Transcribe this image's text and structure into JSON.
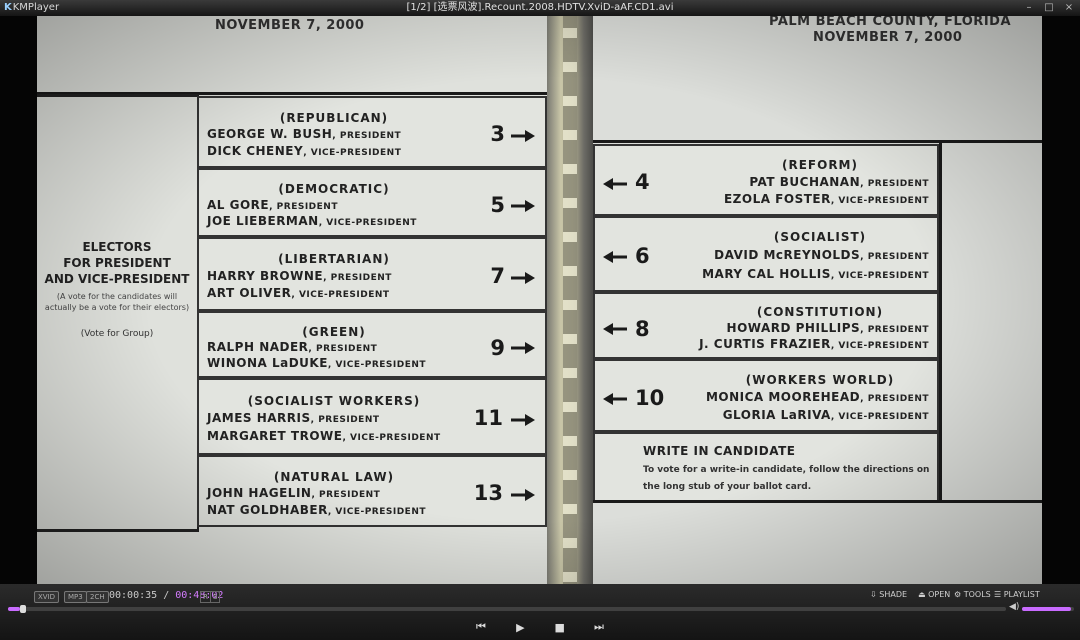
{
  "app": {
    "name": "KMPlayer",
    "title": "[1/2] [选票风波].Recount.2008.HDTV.XviD-aAF.CD1.avi"
  },
  "window_buttons": [
    "–",
    "□",
    "×"
  ],
  "ballot": {
    "left_date": "NOVEMBER 7, 2000",
    "right_county": "PALM BEACH COUNTY, FLORIDA",
    "right_date": "NOVEMBER 7, 2000",
    "electors_heading": [
      "ELECTORS",
      "FOR PRESIDENT",
      "AND VICE-PRESIDENT"
    ],
    "electors_note": [
      "(A vote for the candidates will",
      "actually be a vote for their electors)"
    ],
    "electors_vote": "(Vote for Group)",
    "left": [
      {
        "party": "(REPUBLICAN)",
        "pres": "GEORGE W. BUSH",
        "vp": "DICK CHENEY",
        "num": "3"
      },
      {
        "party": "(DEMOCRATIC)",
        "pres": "AL GORE",
        "vp": "JOE LIEBERMAN",
        "num": "5"
      },
      {
        "party": "(LIBERTARIAN)",
        "pres": "HARRY BROWNE",
        "vp": "ART OLIVER",
        "num": "7"
      },
      {
        "party": "(GREEN)",
        "pres": "RALPH NADER",
        "vp": "WINONA LaDUKE",
        "num": "9"
      },
      {
        "party": "(SOCIALIST WORKERS)",
        "pres": "JAMES HARRIS",
        "vp": "MARGARET TROWE",
        "num": "11"
      },
      {
        "party": "(NATURAL LAW)",
        "pres": "JOHN HAGELIN",
        "vp": "NAT GOLDHABER",
        "num": "13"
      }
    ],
    "right": [
      {
        "party": "(REFORM)",
        "pres": "PAT BUCHANAN",
        "vp": "EZOLA FOSTER",
        "num": "4"
      },
      {
        "party": "(SOCIALIST)",
        "pres": "DAVID McREYNOLDS",
        "vp": "MARY CAL HOLLIS",
        "num": "6"
      },
      {
        "party": "(CONSTITUTION)",
        "pres": "HOWARD PHILLIPS",
        "vp": "J. CURTIS FRAZIER",
        "num": "8"
      },
      {
        "party": "(WORKERS WORLD)",
        "pres": "MONICA MOOREHEAD",
        "vp": "GLORIA LaRIVA",
        "num": "10"
      }
    ],
    "pres_suffix": ", PRESIDENT",
    "vp_suffix": ", VICE-PRESIDENT",
    "writein_heading": "WRITE IN CANDIDATE",
    "writein_text": "To vote for a write-in candidate, follow the directions on the long stub of your ballot card."
  },
  "controls": {
    "badges": [
      "XVID",
      "MP3",
      "2CH"
    ],
    "time_elapsed": "00:00:35",
    "time_separator": " / ",
    "time_total": "00:48:02",
    "rs": [
      "R",
      "S"
    ],
    "right_buttons": [
      "SHADE",
      "OPEN",
      "TOOLS",
      "PLAYLIST"
    ],
    "right_icons": [
      "⇩",
      "⏏",
      "⚙",
      "☰"
    ],
    "progress_fraction": 0.012,
    "volume_fraction": 0.95,
    "accent": "#c86bff"
  }
}
